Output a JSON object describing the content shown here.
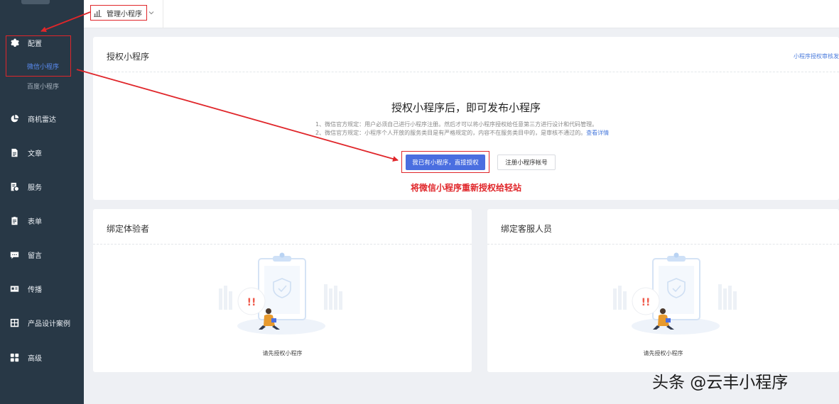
{
  "sidebar": {
    "items": [
      {
        "label": "配置",
        "icon": "gear-icon"
      },
      {
        "label": "商机雷达",
        "icon": "pie-chart-icon"
      },
      {
        "label": "文章",
        "icon": "document-icon"
      },
      {
        "label": "服务",
        "icon": "service-icon"
      },
      {
        "label": "表单",
        "icon": "clipboard-icon"
      },
      {
        "label": "留言",
        "icon": "chat-icon"
      },
      {
        "label": "传播",
        "icon": "id-card-icon"
      },
      {
        "label": "产品设计案例",
        "icon": "grid-icon"
      },
      {
        "label": "高级",
        "icon": "apps-icon"
      }
    ],
    "sub_items": [
      {
        "label": "微信小程序",
        "active": true
      },
      {
        "label": "百度小程序",
        "active": false
      }
    ]
  },
  "topbar": {
    "switch_label": "管理小程序"
  },
  "auth_card": {
    "title": "授权小程序",
    "top_link": "小程序授权审核发",
    "headline": "授权小程序后，即可发布小程序",
    "rule1": "1、微信官方规定：用户必须自己进行小程序注册。然后才可以将小程序授权给任意第三方进行设计和代码管理。",
    "rule2": "2、微信官方规定：小程序个人开放的服务类目是有严格规定的，内容不在服务类目中的，是审核不通过的。",
    "rule2_link": "查看详情",
    "primary_button": "我已有小程序，直接授权",
    "secondary_button": "注册小程序帐号",
    "annotation": "将微信小程序重新授权给轻站"
  },
  "tester_card": {
    "title": "绑定体验者",
    "empty_text": "请先授权小程序"
  },
  "service_card": {
    "title": "绑定客服人员",
    "empty_text": "请先授权小程序"
  },
  "illustration": {
    "alert_text": "!!"
  },
  "watermark": "头条 @云丰小程序",
  "colors": {
    "sidebar_bg": "#283846",
    "accent_blue": "#4a6ee0",
    "annotation_red": "#e0262a"
  }
}
